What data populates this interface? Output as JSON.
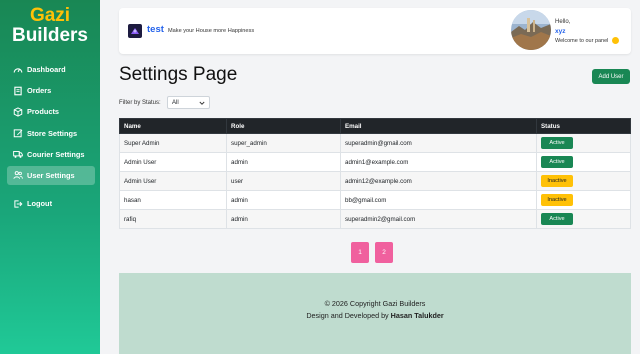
{
  "brand": {
    "line1": "Gazi",
    "line2": "Builders"
  },
  "sidebar": {
    "items": [
      {
        "label": "Dashboard",
        "icon": "gauge-icon",
        "active": false
      },
      {
        "label": "Orders",
        "icon": "receipt-icon",
        "active": false
      },
      {
        "label": "Products",
        "icon": "box-icon",
        "active": false
      },
      {
        "label": "Store Settings",
        "icon": "edit-icon",
        "active": false
      },
      {
        "label": "Courier Settings",
        "icon": "truck-icon",
        "active": false
      },
      {
        "label": "User Settings",
        "icon": "users-icon",
        "active": true
      }
    ],
    "logout": {
      "label": "Logout",
      "icon": "logout-icon"
    }
  },
  "topbar": {
    "site_name": "test",
    "tagline": "Make your House more Happiness",
    "hello": "Hello,",
    "username": "xyz",
    "welcome": "Welcome to our panel"
  },
  "main": {
    "title": "Settings Page",
    "add_user_label": "Add User",
    "filter_label": "Filter by Status:",
    "filter_value": "All"
  },
  "table": {
    "headers": [
      "Name",
      "Role",
      "Email",
      "Status"
    ],
    "rows": [
      {
        "name": "Super Admin",
        "role": "super_admin",
        "email": "superadmin@gmail.com",
        "status": "Active"
      },
      {
        "name": "Admin User",
        "role": "admin",
        "email": "admin1@example.com",
        "status": "Active"
      },
      {
        "name": "Admin User",
        "role": "user",
        "email": "admin12@example.com",
        "status": "Inactive"
      },
      {
        "name": "hasan",
        "role": "admin",
        "email": "bb@gmail.com",
        "status": "Inactive"
      },
      {
        "name": "rafiq",
        "role": "admin",
        "email": "superadmin2@gmail.com",
        "status": "Active"
      }
    ]
  },
  "pagination": {
    "pages": [
      "1",
      "2"
    ]
  },
  "footer": {
    "copyright": "© 2026 Copyright Gazi Builders",
    "developed_prefix": "Design and Developed by",
    "developer": "Hasan Talukder"
  },
  "colors": {
    "accent_green": "#198754",
    "brand_yellow": "#ffc107",
    "pager_pink": "#f0609e",
    "footer_bg": "#bfdccf"
  }
}
